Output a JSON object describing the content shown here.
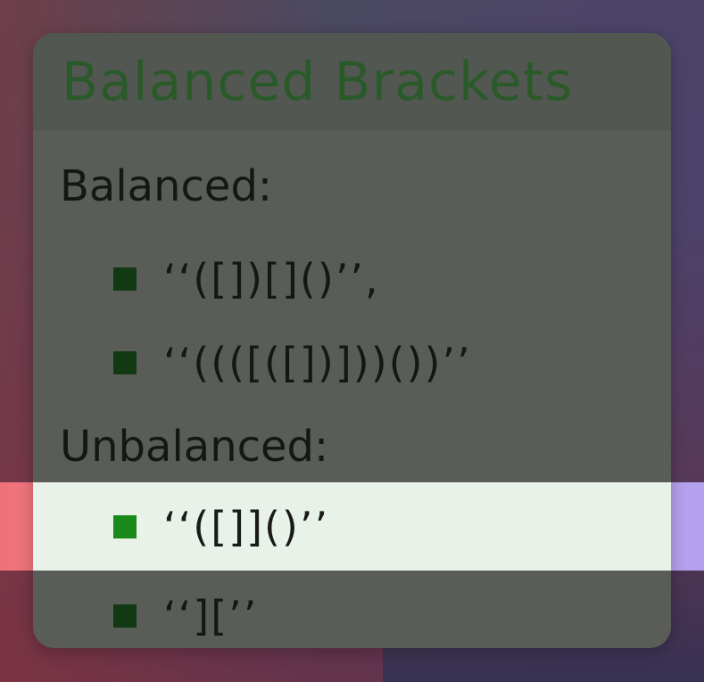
{
  "slide": {
    "title": "Balanced Brackets",
    "balanced_label": "Balanced:",
    "unbalanced_label": "Unbalanced:",
    "balanced_items": [
      "‘‘([])[]()’’,",
      "‘‘((([([])]))())’’"
    ],
    "unbalanced_items": [
      "‘‘([]]()’’",
      "‘‘][’’"
    ]
  },
  "colors": {
    "title": "#2a5a2a",
    "bullet": "#123a12",
    "highlight_bullet": "#1a8a1a",
    "highlight_row": "#e9f2e9"
  },
  "icons": {
    "bullet": "square-bullet-icon"
  }
}
